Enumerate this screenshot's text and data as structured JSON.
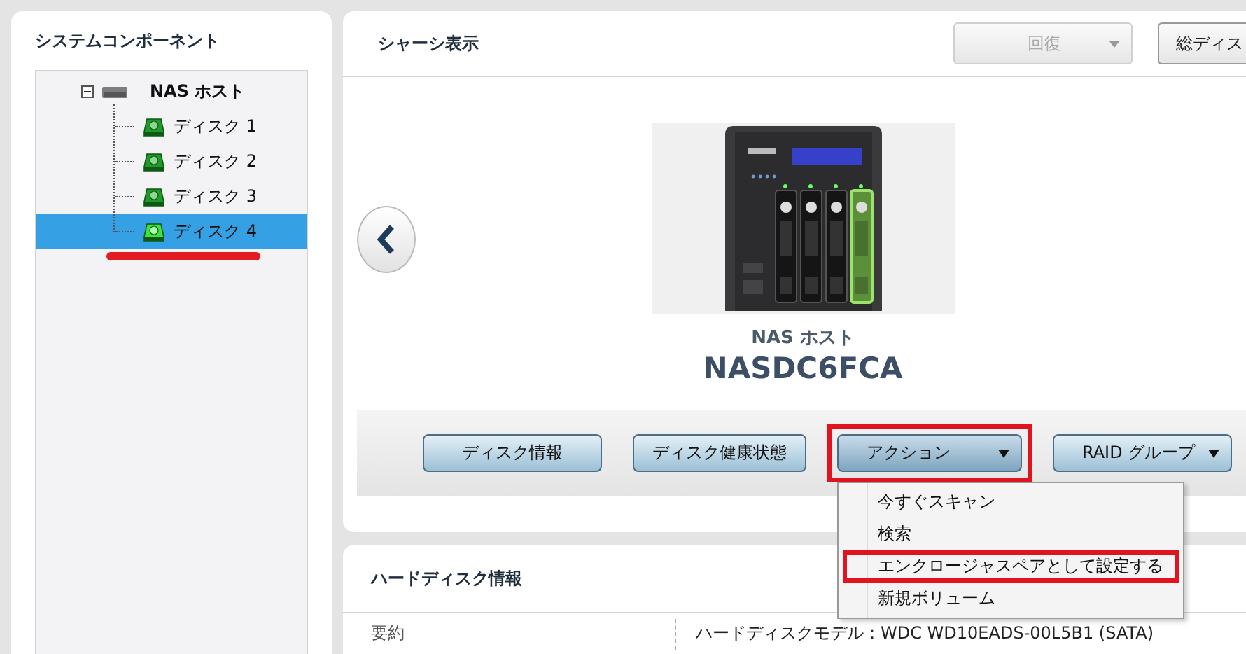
{
  "sidebar": {
    "title": "システムコンポーネント",
    "tree": {
      "label": "NAS ホスト",
      "expanded": true,
      "children": [
        {
          "label": "ディスク 1",
          "selected": false,
          "annotated": false
        },
        {
          "label": "ディスク 2",
          "selected": false,
          "annotated": false
        },
        {
          "label": "ディスク 3",
          "selected": false,
          "annotated": false
        },
        {
          "label": "ディスク 4",
          "selected": true,
          "annotated": true
        }
      ]
    }
  },
  "chassis": {
    "title": "シャーシ表示",
    "toolbar": [
      {
        "label": "回復",
        "kind": "dropdown",
        "disabled": true
      },
      {
        "label": "総ディス",
        "kind": "button",
        "disabled": false
      }
    ],
    "device": {
      "bays": [
        {
          "selected": false
        },
        {
          "selected": false
        },
        {
          "selected": false
        },
        {
          "selected": true
        }
      ],
      "type": "NAS ホスト",
      "name": "NASDC6FCA"
    },
    "actions": [
      {
        "label": "ディスク情報",
        "kind": "button",
        "annotated": false
      },
      {
        "label": "ディスク健康状態",
        "kind": "button",
        "annotated": false
      },
      {
        "label": "アクション",
        "kind": "dropdown",
        "annotated": true,
        "expanded": true
      },
      {
        "label": "RAID グループ",
        "kind": "dropdown",
        "annotated": false,
        "expanded": false
      }
    ],
    "menu": [
      {
        "label": "今すぐスキャン",
        "annotated": false
      },
      {
        "label": "検索",
        "annotated": false
      },
      {
        "label": "エンクロージャスペアとして設定する",
        "annotated": true
      },
      {
        "label": "新規ボリューム",
        "annotated": false
      }
    ]
  },
  "disk_info": {
    "title": "ハードディスク情報",
    "rows": [
      {
        "label": "要約",
        "value": "ハードディスクモデル：WDC WD10EADS-00L5B1 (SATA)"
      }
    ]
  }
}
